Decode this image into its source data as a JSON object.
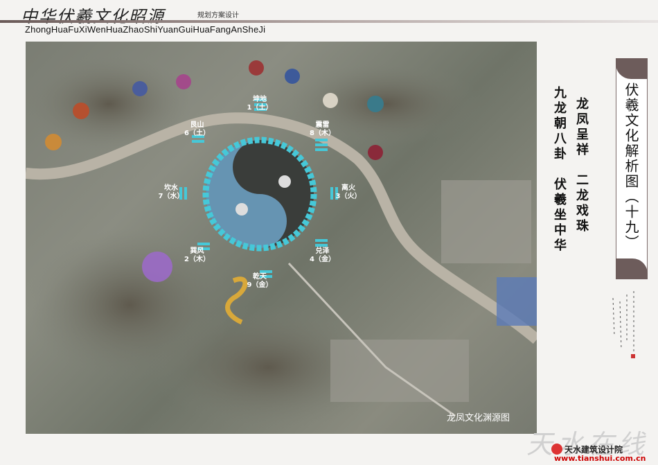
{
  "header": {
    "calligraphy_title": "中华伏羲文化昭源",
    "subtitle": "规划方案设计",
    "pinyin": "ZhongHuaFuXiWenHuaZhaoShiYuanGuiHuaFangAnSheJi"
  },
  "panel": {
    "title": "伏羲文化解析图（十九）"
  },
  "captions": {
    "line1": "龙凤呈祥　二龙戏珠",
    "line2": "九龙朝八卦　伏羲坐中华"
  },
  "map": {
    "label": "龙凤文化渊源图"
  },
  "trigrams": [
    {
      "name": "坤地",
      "num": "1（土）"
    },
    {
      "name": "震雷",
      "num": "8（木）"
    },
    {
      "name": "离火",
      "num": "3（火）"
    },
    {
      "name": "兑泽",
      "num": "4（金）"
    },
    {
      "name": "乾天",
      "num": "9（金）"
    },
    {
      "name": "巽风",
      "num": "2（木）"
    },
    {
      "name": "坎水",
      "num": "7（水）"
    },
    {
      "name": "艮山",
      "num": "6（土）"
    }
  ],
  "footer": {
    "org": "天水建筑设计院",
    "url": "www.tianshui.com.cn",
    "watermark": "天水在线"
  },
  "colors": {
    "accent": "#46c8d8",
    "panel_frame": "#6d5c5b"
  }
}
